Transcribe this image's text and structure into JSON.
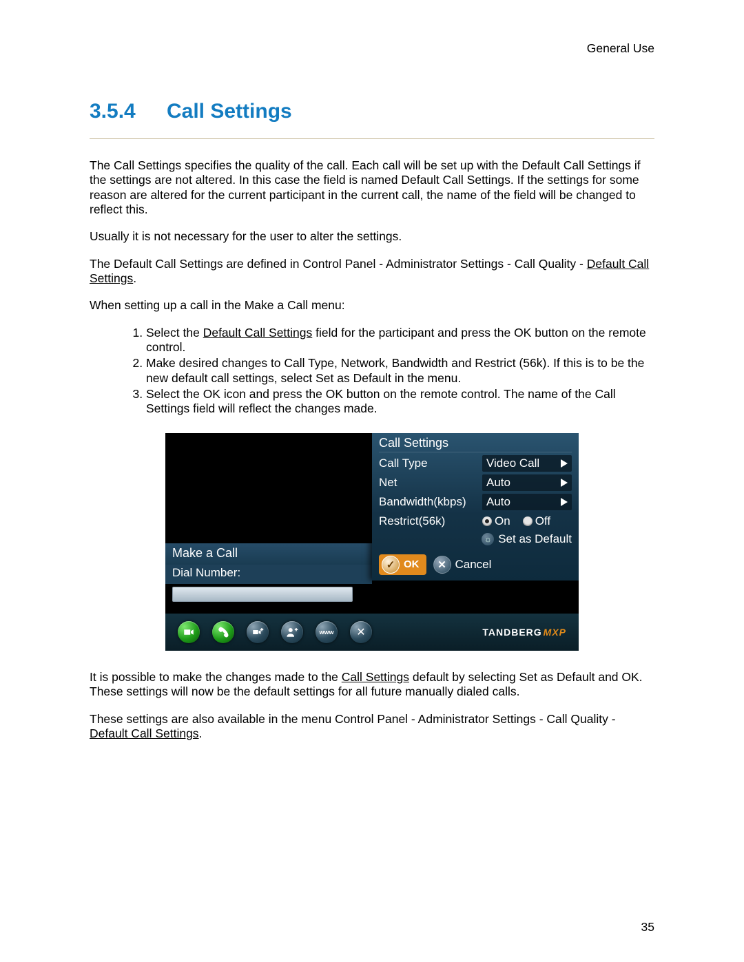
{
  "header": {
    "category": "General Use"
  },
  "heading": {
    "number": "3.5.4",
    "title": "Call Settings"
  },
  "paragraphs": {
    "p1": "The Call Settings specifies the quality of the call. Each call will be set up with the Default Call Settings if the settings are not altered. In this case the field is named Default Call Settings. If the settings for some reason are altered for the current participant in the current call, the name of the field will be changed to reflect this.",
    "p2": "Usually it is not necessary for the user to alter the settings.",
    "p3a": "The Default Call Settings are defined in Control Panel - Administrator Settings - Call Quality - ",
    "p3_link": "Default Call Settings",
    "p3b": ".",
    "p4": "When setting up a call in the Make a Call menu:",
    "p5a": "It is possible to make the changes made to the ",
    "p5_link": "Call Settings",
    "p5b": " default by selecting Set as Default and OK. These settings will now be the default settings for all future manually dialed calls.",
    "p6a": "These settings are also available in the menu Control Panel - Administrator Settings - Call Quality - ",
    "p6_link": "Default Call Settings",
    "p6b": "."
  },
  "steps": {
    "s1a": "Select the ",
    "s1_link": "Default Call Settings",
    "s1b": " field for the participant and press the OK button on the remote control.",
    "s2": "Make desired changes to Call Type, Network, Bandwidth and Restrict (56k). If this is to be the new default call settings, select Set as Default in the menu.",
    "s3": "Select the OK icon and press the OK button on the remote control. The name of the Call Settings field will reflect the changes made."
  },
  "ui": {
    "make_call_title": "Make a Call",
    "dial_label": "Dial Number:",
    "dial_value": "",
    "panel_title": "Call Settings",
    "rows": {
      "call_type": {
        "label": "Call Type",
        "value": "Video Call"
      },
      "net": {
        "label": "Net",
        "value": "Auto"
      },
      "bandwidth": {
        "label": "Bandwidth(kbps)",
        "value": "Auto"
      },
      "restrict": {
        "label": "Restrict(56k)",
        "on": "On",
        "off": "Off",
        "selected": "On"
      }
    },
    "set_default": "Set as Default",
    "ok": "OK",
    "cancel": "Cancel",
    "brand": "TANDBERG",
    "brand_suffix": "MXP"
  },
  "page_number": "35"
}
